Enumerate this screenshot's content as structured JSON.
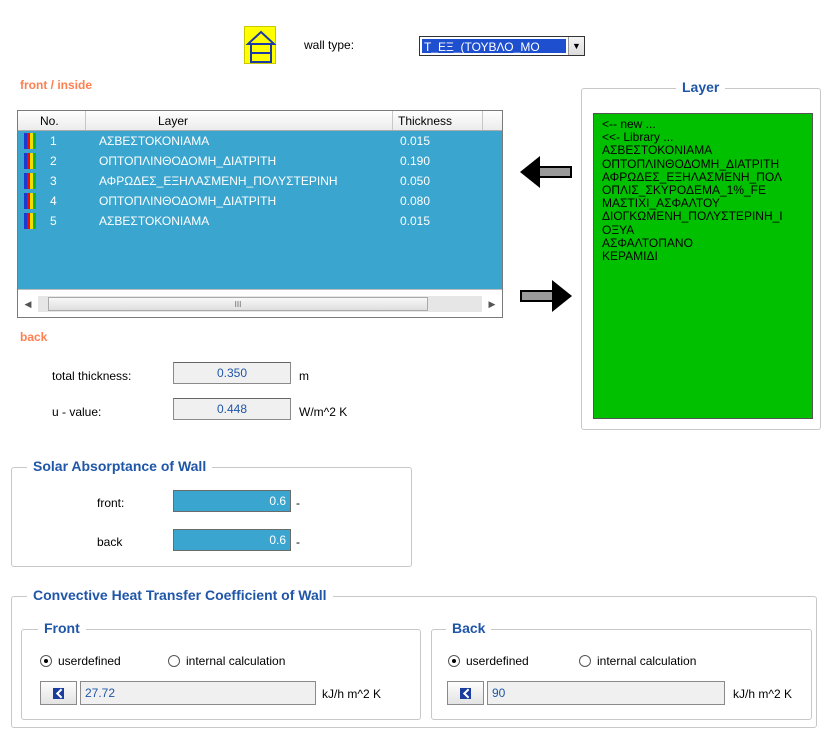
{
  "header": {
    "wall_type_label": "wall type:",
    "wall_type_value": "T_EΞ_(ΤΟΥΒΛΟ_ΜΟ",
    "house_icon": "house-icon"
  },
  "labels": {
    "front_inside": "front / inside",
    "back": "back"
  },
  "layers_table": {
    "columns": [
      "No.",
      "Layer",
      "Thickness"
    ],
    "rows": [
      {
        "no": "1",
        "layer": "ΑΣΒΕΣΤΟΚΟΝΙΑΜΑ",
        "thickness": "0.015"
      },
      {
        "no": "2",
        "layer": "ΟΠΤΟΠΛΙΝΘΟΔΟΜΗ_ΔΙΑΤΡΙΤΗ",
        "thickness": "0.190"
      },
      {
        "no": "3",
        "layer": "ΑΦΡΩΔΕΣ_ΕΞΗΛΑΣΜΕΝΗ_ΠΟΛΥΣΤΕΡΙΝΗ",
        "thickness": "0.050"
      },
      {
        "no": "4",
        "layer": "ΟΠΤΟΠΛΙΝΘΟΔΟΜΗ_ΔΙΑΤΡΙΤΗ",
        "thickness": "0.080"
      },
      {
        "no": "5",
        "layer": "ΑΣΒΕΣΤΟΚΟΝΙΑΜΑ",
        "thickness": "0.015"
      }
    ],
    "stripe_colors": [
      "#1a3bd1",
      "#e01010",
      "#f0e000",
      "#18b018"
    ],
    "scroll_thumb_glyph": "III"
  },
  "layer_panel": {
    "title": "Layer",
    "items": [
      "<-- new ...",
      "<<- Library ...",
      "ΑΣΒΕΣΤΟΚΟΝΙΑΜΑ",
      "ΟΠΤΟΠΛΙΝΘΟΔΟΜΗ_ΔΙΑΤΡΙΤΗ",
      "ΑΦΡΩΔΕΣ_ΕΞΗΛΑΣΜΕΝΗ_ΠΟΛ",
      "ΟΠΛΙΣ_ΣΚΥΡΟΔΕΜΑ_1%_FE",
      "ΜΑΣΤΙΧΙ_ΑΣΦΑΛΤΟΥ",
      "ΔΙΟΓΚΩΜΕΝΗ_ΠΟΛΥΣΤΕΡΙΝΗ_Ι",
      "ΟΞΥΑ",
      "ΑΣΦΑΛΤΟΠΑΝΟ",
      "ΚΕΡΑΜΙΔΙ"
    ]
  },
  "totals": {
    "total_thickness_label": "total thickness:",
    "total_thickness_value": "0.350",
    "total_thickness_unit": "m",
    "u_value_label": "u - value:",
    "u_value_value": "0.448",
    "u_value_unit": "W/m^2 K"
  },
  "solar": {
    "title": "Solar Absorptance of Wall",
    "front_label": "front:",
    "front_value": "0.6",
    "back_label": "back",
    "back_value": "0.6",
    "unit": "-"
  },
  "convective": {
    "title": "Convective Heat Transfer Coefficient of Wall",
    "front": {
      "title": "Front",
      "opt_user": "userdefined",
      "opt_internal": "internal calculation",
      "selected": "userdefined",
      "value": "27.72",
      "unit": "kJ/h m^2 K"
    },
    "back": {
      "title": "Back",
      "opt_user": "userdefined",
      "opt_internal": "internal calculation",
      "selected": "userdefined",
      "value": "90",
      "unit": "kJ/h m^2 K"
    }
  }
}
